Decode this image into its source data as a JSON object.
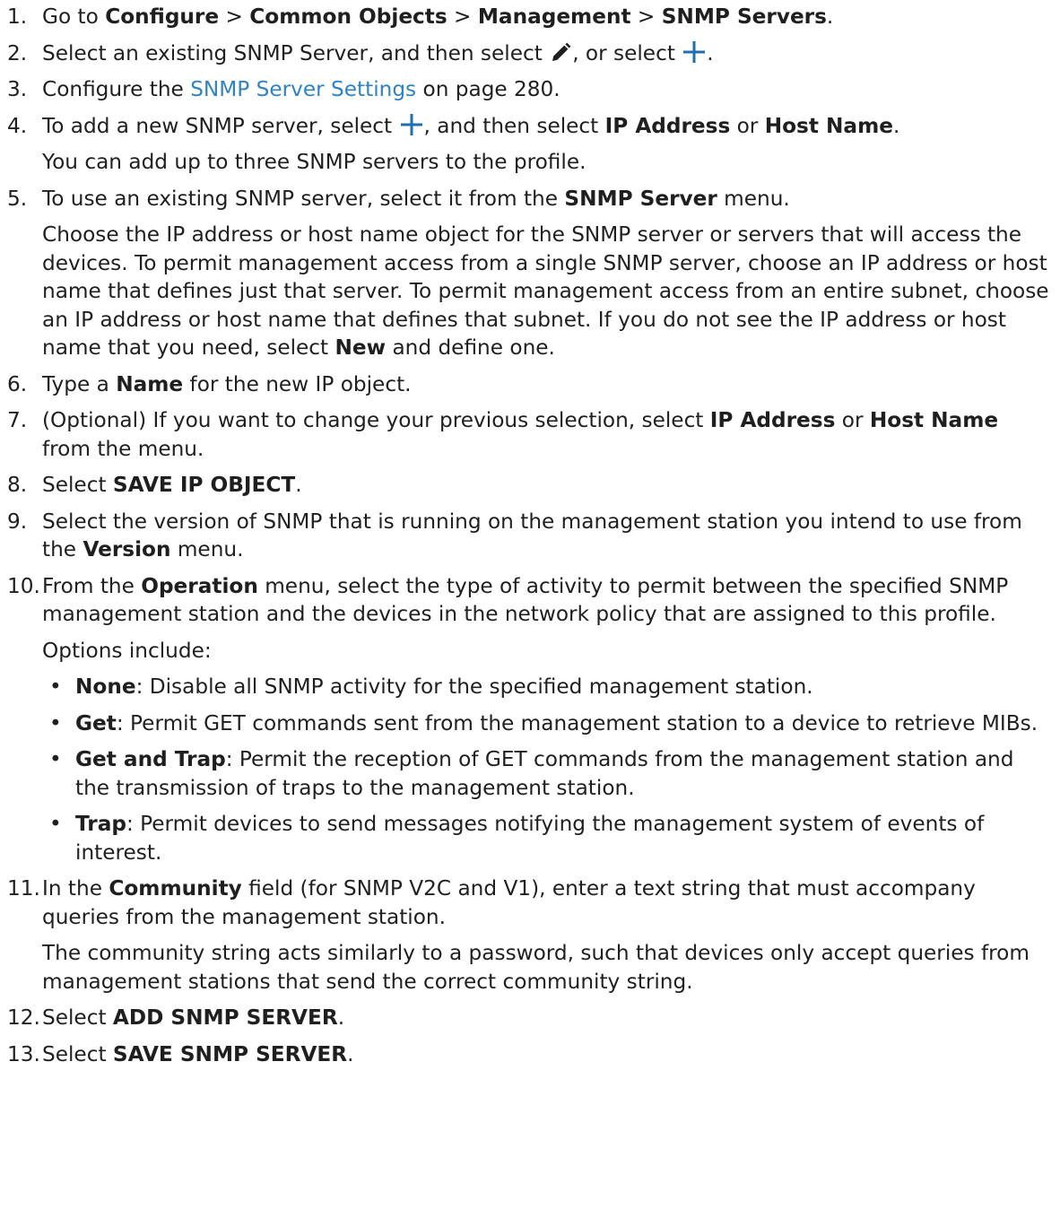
{
  "steps": {
    "s1": {
      "num": "1.",
      "a": "Go to ",
      "b1": "Configure",
      "sep1": " > ",
      "b2": "Common Objects",
      "sep2": " > ",
      "b3": "Management",
      "sep3": " > ",
      "b4": "SNMP Servers",
      "end": "."
    },
    "s2": {
      "num": "2.",
      "a": "Select an existing SNMP Server, and then select ",
      "b": ", or select ",
      "end": "."
    },
    "s3": {
      "num": "3.",
      "a": "Configure the ",
      "link": "SNMP Server Settings",
      "b": " on page 280."
    },
    "s4": {
      "num": "4.",
      "a": "To add a new SNMP server, select ",
      "b": ", and then select ",
      "b1": "IP Address",
      "c": " or ",
      "b2": "Host Name",
      "end": ".",
      "note": "You can add up to three SNMP servers to the profile."
    },
    "s5": {
      "num": "5.",
      "a": "To use an existing SNMP server, select it from the ",
      "b1": "SNMP Server",
      "end": " menu.",
      "note_a": "Choose the IP address or host name object for the SNMP server or servers that will access the devices. To permit management access from a single SNMP server, choose an IP address or host name that defines just that server. To permit management access from an entire subnet, choose an IP address or host name that defines that subnet. If you do not see the IP address or host name that you need, select ",
      "note_b": "New",
      "note_c": " and define one."
    },
    "s6": {
      "num": "6.",
      "a": "Type a ",
      "b1": "Name",
      "end": " for the new IP object."
    },
    "s7": {
      "num": "7.",
      "a": "(Optional) If you want to change your previous selection, select ",
      "b1": "IP Address",
      "c": " or ",
      "b2": "Host Name",
      "end": " from the menu."
    },
    "s8": {
      "num": "8.",
      "a": "Select ",
      "b1": "SAVE IP OBJECT",
      "end": "."
    },
    "s9": {
      "num": "9.",
      "a": "Select the version of SNMP that is running on the management station you intend to use from the ",
      "b1": "Version",
      "end": " menu."
    },
    "s10": {
      "num": "10.",
      "a": "From the ",
      "b1": "Operation",
      "end": " menu, select the type of activity to permit between the specified SNMP management station and the devices in the network policy that are assigned to this profile.",
      "note": "Options include:"
    },
    "s11": {
      "num": "11.",
      "a": "In the ",
      "b1": "Community",
      "end": " field (for SNMP V2C and V1), enter a text string that must accompany queries from the management station.",
      "note": "The community string acts similarly to a password, such that devices only accept queries from management stations that send the correct community string."
    },
    "s12": {
      "num": "12.",
      "a": "Select ",
      "b1": "ADD SNMP SERVER",
      "end": "."
    },
    "s13": {
      "num": "13.",
      "a": "Select ",
      "b1": "SAVE SNMP SERVER",
      "end": "."
    }
  },
  "options": [
    {
      "term": "None",
      "desc": ": Disable all SNMP activity for the specified management station."
    },
    {
      "term": "Get",
      "desc": ": Permit GET commands sent from the management station to a device to retrieve MIBs."
    },
    {
      "term": "Get and Trap",
      "desc": ": Permit the reception of GET commands from the management station and the transmission of traps to the management station."
    },
    {
      "term": "Trap",
      "desc": ": Permit devices to send messages notifying the management system of events of interest."
    }
  ],
  "bullet_char": "•",
  "icons": {
    "edit": "pencil-icon",
    "add": "plus-icon"
  },
  "colors": {
    "link": "#2f83c3",
    "text": "#1f1f1f",
    "plus": "#1e6fb0"
  }
}
